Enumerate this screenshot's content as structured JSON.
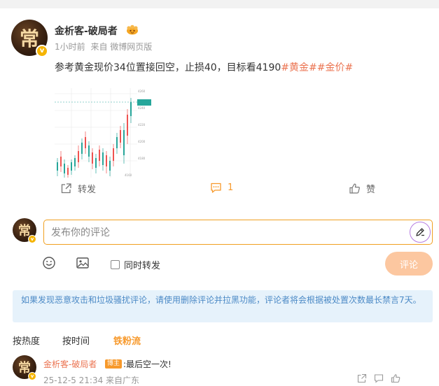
{
  "post": {
    "avatar_char": "常",
    "verified_char": "v",
    "author": "金析客-破局者",
    "time": "1小时前",
    "source": "来自 微博网页版",
    "text": "参考黄金现价34位置接回空，止损40，目标看4190",
    "tags": [
      "#黄金#",
      "#金价#"
    ],
    "image_icon": "candlestick-chart-thumbnail"
  },
  "actions": {
    "forward_label": "转发",
    "comment_count": "1",
    "like_label": "赞"
  },
  "compose": {
    "avatar_char": "常",
    "placeholder": "发布你的评论",
    "forward_checkbox_label": "同时转发",
    "checkbox_checked": false,
    "submit_label": "评论"
  },
  "notice": {
    "text": "如果发现恶意攻击和垃圾骚扰评论，请使用删除评论并拉黑功能，评论者将会根据被处置次数最长禁言7天。"
  },
  "sort": {
    "options": [
      "按热度",
      "按时间",
      "铁粉流"
    ],
    "active": "铁粉流"
  },
  "comment": {
    "avatar_char": "常",
    "author": "金析客-破局者",
    "badge": "博主",
    "text": ":最后空一次!",
    "meta": "25-12-5 21:34 来自广东"
  },
  "colors": {
    "accent": "#f7992b",
    "link": "#eb7350",
    "notice_text": "#4c8ac6",
    "notice_bg": "#e6f2fb",
    "submit_disabled": "#fcc7a0"
  }
}
